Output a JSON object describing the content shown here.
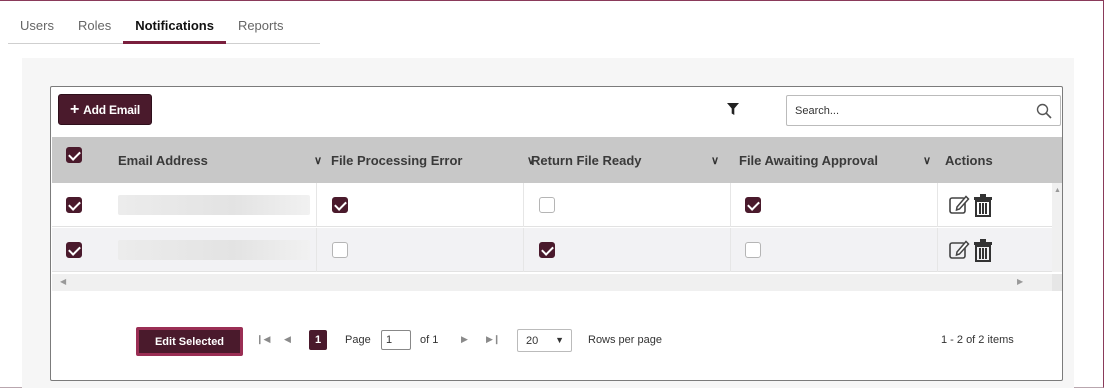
{
  "tabs": [
    {
      "label": "Users"
    },
    {
      "label": "Roles"
    },
    {
      "label": "Notifications",
      "active": true
    },
    {
      "label": "Reports"
    }
  ],
  "toolbar": {
    "add_label": "Add Email",
    "search_placeholder": "Search...",
    "filter_icon": "filter-icon",
    "search_icon": "search-icon"
  },
  "grid": {
    "columns": [
      {
        "label": "Email Address"
      },
      {
        "label": "File Processing Error"
      },
      {
        "label": "Return File Ready"
      },
      {
        "label": "File Awaiting Approval"
      },
      {
        "label": "Actions"
      }
    ],
    "select_all_checked": true,
    "rows": [
      {
        "selected": true,
        "email": "",
        "file_processing_error": true,
        "return_file_ready": false,
        "file_awaiting_approval": true
      },
      {
        "selected": true,
        "email": "",
        "file_processing_error": false,
        "return_file_ready": true,
        "file_awaiting_approval": false
      }
    ]
  },
  "pager": {
    "edit_selected_label": "Edit Selected",
    "current_page": "1",
    "page_label": "Page",
    "page_input_value": "1",
    "of_label": "of 1",
    "rows_per_page_value": "20",
    "rows_per_page_label": "Rows per page",
    "items_summary": "1 - 2 of 2 items"
  },
  "colors": {
    "brand": "#4a1a2c",
    "tab_underline": "#7a1f3d",
    "header_bg": "#c8c8c8"
  }
}
